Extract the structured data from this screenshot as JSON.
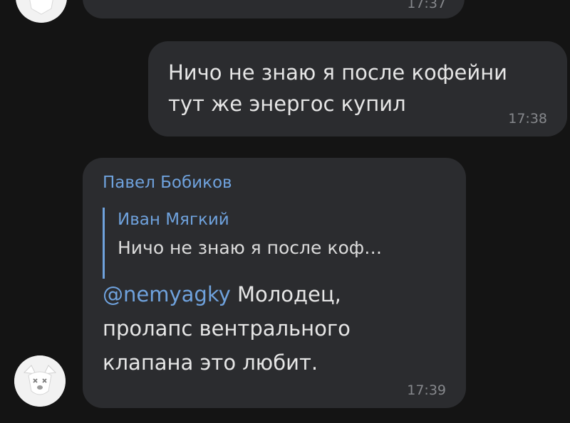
{
  "messages": {
    "top_partial": {
      "time": "17:37"
    },
    "outgoing": {
      "text": "Ничо не знаю я после кофейни\nтут же энергос купил",
      "time": "17:38"
    },
    "incoming": {
      "sender": "Павел Бобиков",
      "reply_author": "Иван Мягкий",
      "reply_text": "Ничо не знаю я после коф…",
      "mention": "@nemyagky",
      "text_after_mention": " Молодец,",
      "text_rest": "пролапс вентрального клапана это любит.",
      "time": "17:39"
    }
  },
  "avatar": {
    "icon": "dog-face-avatar-icon"
  },
  "colors": {
    "background": "#141414",
    "bubble": "#2b2c2f",
    "accent": "#6fa2dd",
    "text": "#e6e6e6",
    "time": "#86888c"
  }
}
